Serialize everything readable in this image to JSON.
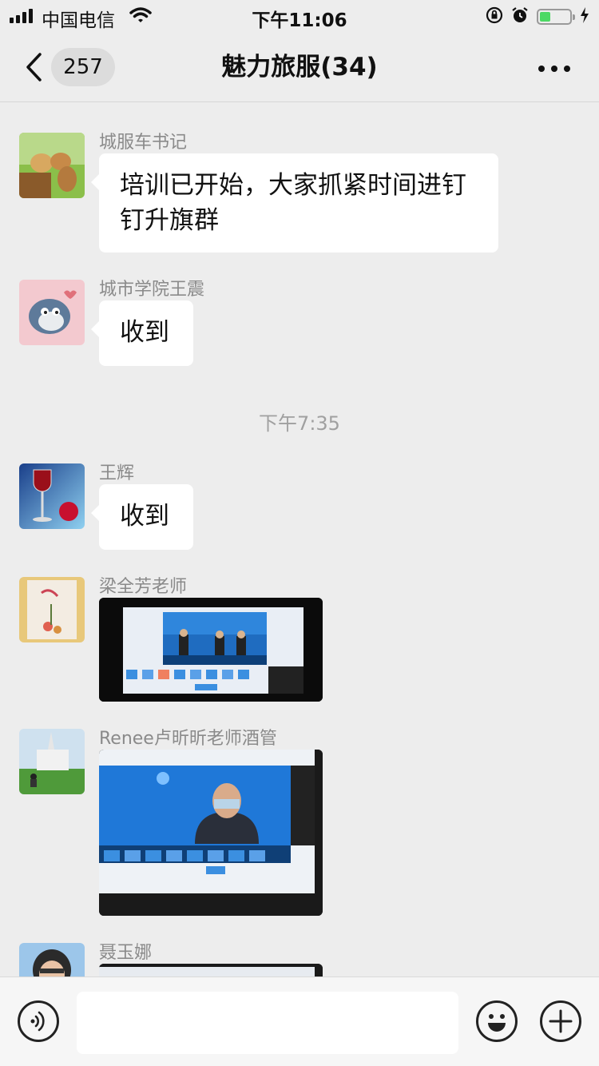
{
  "status_bar": {
    "carrier": "中国电信",
    "time": "下午11:06"
  },
  "nav": {
    "unread_count": "257",
    "title": "魅力旅服(34)"
  },
  "messages": [
    {
      "sender": "城服车书记",
      "text": "培训已开始，大家抓紧时间进钉钉升旗群"
    },
    {
      "sender": "城市学院王震",
      "text": "收到"
    },
    {
      "sender": "王辉",
      "text": "收到"
    },
    {
      "sender": "梁全芳老师"
    },
    {
      "sender": "Renee卢昕昕老师酒管"
    },
    {
      "sender": "聂玉娜"
    }
  ],
  "timestamp": "下午7:35",
  "icons": {
    "back": "chevron-left-icon",
    "more": "more-dots-icon",
    "voice": "voice-icon",
    "emoji": "emoji-icon",
    "add": "plus-icon",
    "signal": "signal-icon",
    "wifi": "wifi-icon",
    "lock": "orientation-lock-icon",
    "alarm": "alarm-icon",
    "battery": "battery-icon"
  },
  "colors": {
    "background": "#ededed",
    "bubble": "#ffffff",
    "battery_fill": "#4cd964"
  },
  "battery_level": 0.3
}
